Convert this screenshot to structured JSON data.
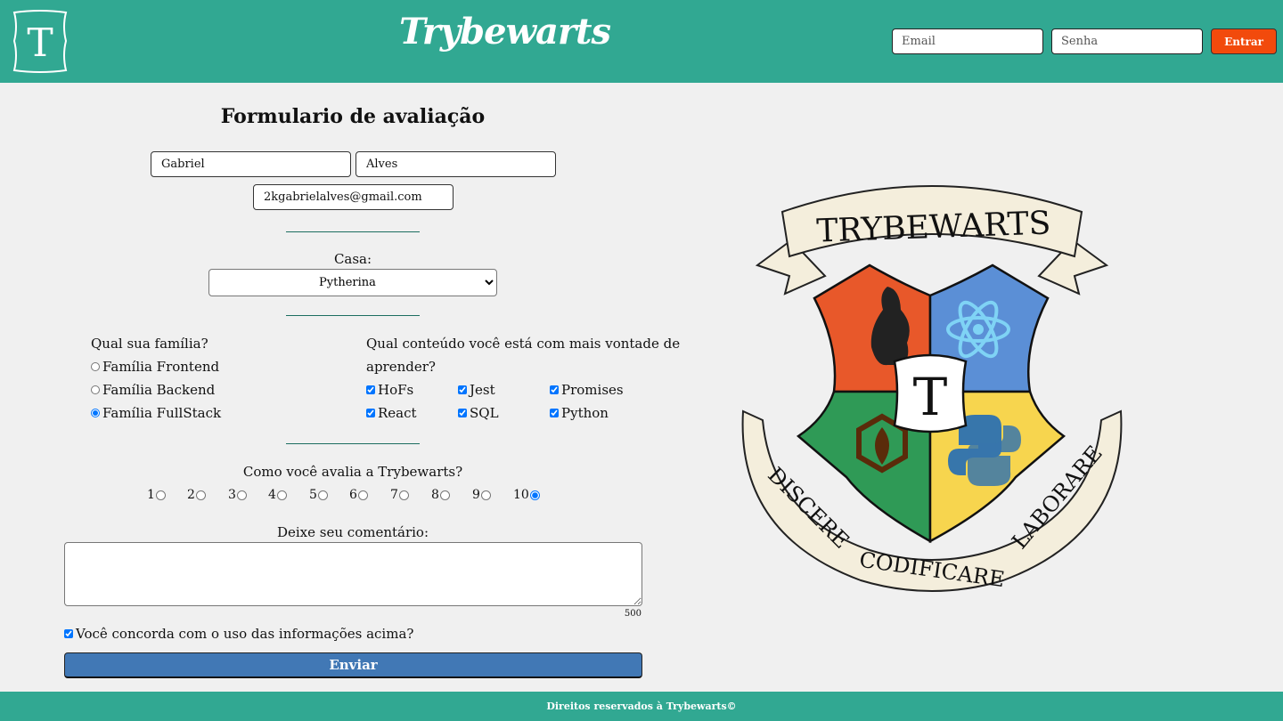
{
  "header": {
    "logo_letter": "T",
    "site_title": "Trybewarts",
    "email_placeholder": "Email",
    "password_placeholder": "Senha",
    "login_button": "Entrar"
  },
  "form": {
    "title": "Formulario de avaliação",
    "first_name": "Gabriel",
    "last_name": "Alves",
    "email": "2kgabrielalves@gmail.com",
    "house_label": "Casa:",
    "house_selected": "Pytherina",
    "family_question": "Qual sua família?",
    "families": [
      {
        "label": "Família Frontend",
        "checked": false
      },
      {
        "label": "Família Backend",
        "checked": false
      },
      {
        "label": "Família FullStack",
        "checked": true
      }
    ],
    "content_question_line1": "Qual conteúdo você está com mais vontade de",
    "content_question_line2": "aprender?",
    "contents": [
      {
        "label": "HoFs",
        "checked": true
      },
      {
        "label": "Jest",
        "checked": true
      },
      {
        "label": "Promises",
        "checked": true
      },
      {
        "label": "React",
        "checked": true
      },
      {
        "label": "SQL",
        "checked": true
      },
      {
        "label": "Python",
        "checked": true
      }
    ],
    "rating_question": "Como você avalia a Trybewarts?",
    "ratings": [
      "1",
      "2",
      "3",
      "4",
      "5",
      "6",
      "7",
      "8",
      "9",
      "10"
    ],
    "rating_selected": 10,
    "comment_label": "Deixe seu comentário:",
    "comment_value": "",
    "char_counter": "500",
    "agreement_label": "Você concorda com o uso das informações acima?",
    "agreement_checked": true,
    "submit_button": "Enviar"
  },
  "crest": {
    "top_banner": "TRYBEWARTS",
    "center_letter": "T",
    "bottom_left": "DISCERE",
    "bottom_center": "CODIFICARE",
    "bottom_right": "LABORARE"
  },
  "footer": {
    "text": "Direitos reservados à Trybewarts©"
  },
  "colors": {
    "header": "#31a892",
    "login_button": "#f24a0c",
    "submit_button": "#4178b5",
    "crest_red": "#e8582a",
    "crest_blue": "#5b8fd6",
    "crest_green": "#2f9a56",
    "crest_yellow": "#f7d54e"
  }
}
